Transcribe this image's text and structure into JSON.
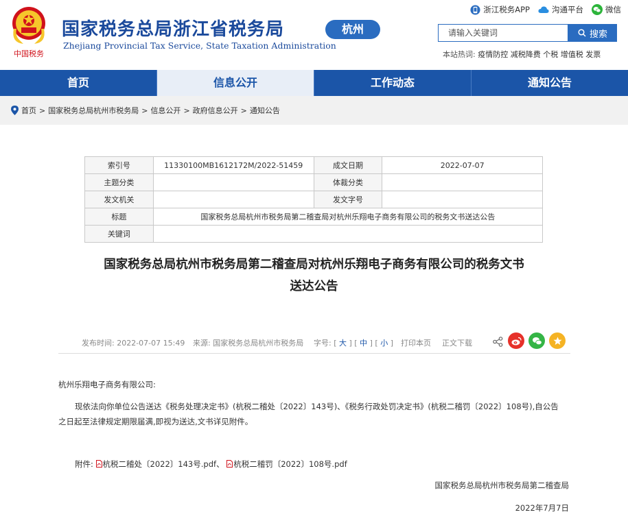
{
  "header": {
    "title": "国家税务总局浙江省税务局",
    "subtitle": "Zhejiang Provincial Tax Service, State Taxation Administration",
    "city": "杭州",
    "emblem_text": "中国税务",
    "links": [
      "浙江税务APP",
      "沟通平台",
      "微信"
    ],
    "search_placeholder": "请输入关键词",
    "search_button": "搜索",
    "hot_label": "本站热词:",
    "hot_words": "疫情防控 减税降费 个税 增值税 发票"
  },
  "nav": [
    "首页",
    "信息公开",
    "工作动态",
    "通知公告"
  ],
  "breadcrumb": [
    "首页",
    "国家税务总局杭州市税务局",
    "信息公开",
    "政府信息公开",
    "通知公告"
  ],
  "meta": {
    "index_label": "索引号",
    "index_value": "11330100MB1612172M/2022-51459",
    "date_label": "成文日期",
    "date_value": "2022-07-07",
    "topic_label": "主题分类",
    "topic_value": "",
    "genre_label": "体裁分类",
    "genre_value": "",
    "issuer_label": "发文机关",
    "issuer_value": "",
    "docno_label": "发文字号",
    "docno_value": "",
    "title_label": "标题",
    "title_value": "国家税务总局杭州市税务局第二稽查局对杭州乐翔电子商务有限公司的税务文书送达公告",
    "keywords_label": "关键词",
    "keywords_value": ""
  },
  "article": {
    "title_line1": "国家税务总局杭州市税务局第二稽查局对杭州乐翔电子商务有限公司的税务文书",
    "title_line2": "送达公告",
    "publish_time": "发布时间: 2022-07-07 15:49",
    "source": "来源: 国家税务总局杭州市税务局",
    "font_label": "字号: [",
    "size_large": "大",
    "size_medium": "中",
    "size_small": "小",
    "print": "打印本页",
    "download": "正文下载",
    "greeting": "杭州乐翔电子商务有限公司:",
    "body": "现依法向你单位公告送达《税务处理决定书》(杭税二稽处〔2022〕143号)、《税务行政处罚决定书》(杭税二稽罚〔2022〕108号),自公告之日起至法律规定期限届满,即视为送达,文书详见附件。",
    "attach_label": "附件:",
    "file1": "杭税二稽处〔2022〕143号.pdf",
    "file_sep": "、",
    "file2": "杭税二稽罚〔2022〕108号.pdf",
    "signer": "国家税务总局杭州市税务局第二稽查局",
    "sign_date": "2022年7月7日"
  },
  "colors": {
    "brand_blue": "#1b55a8",
    "accent_blue": "#2a6cc0",
    "emblem_red": "#d0121b"
  }
}
